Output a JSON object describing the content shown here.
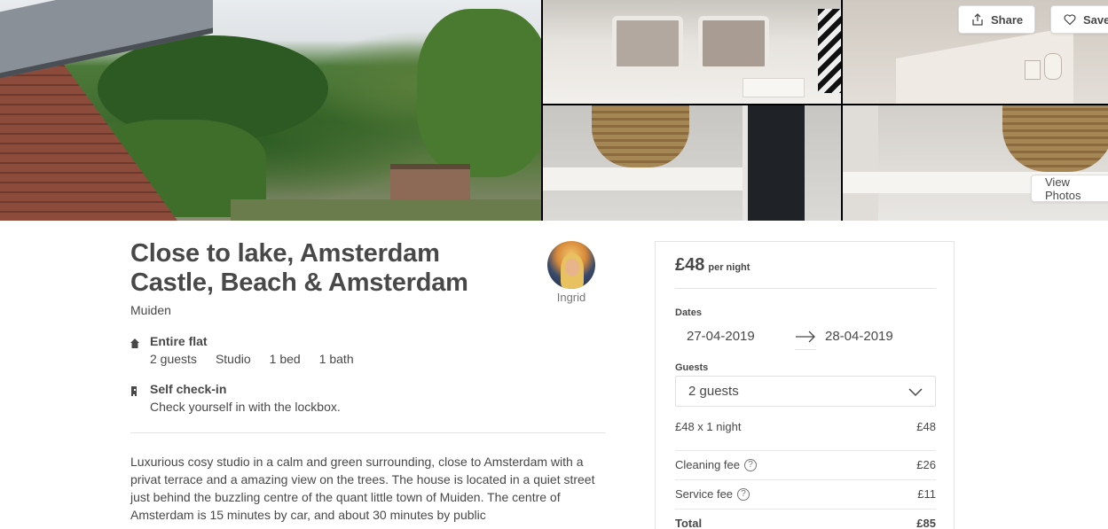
{
  "actions": {
    "share_label": "Share",
    "save_label": "Save",
    "view_photos_label": "View Photos"
  },
  "listing": {
    "title": "Close to lake, Amsterdam Castle, Beach & Amsterdam",
    "location": "Muiden",
    "host_name": "Ingrid",
    "features": [
      {
        "icon": "home-icon",
        "title": "Entire flat",
        "details": [
          "2 guests",
          "Studio",
          "1 bed",
          "1 bath"
        ]
      },
      {
        "icon": "key-icon",
        "title": "Self check-in",
        "subtitle": "Check yourself in with the lockbox."
      }
    ],
    "description": "Luxurious cosy studio in a calm and green surrounding, close to Amsterdam with a privat terrace and a amazing view on the trees. The house is located in a quiet street just behind the buzzling centre of the quant little town of Muiden. The centre of Amsterdam is 15 minutes by car, and about 30 minutes by public"
  },
  "booking": {
    "price": "£48",
    "per_night": "per night",
    "dates_label": "Dates",
    "check_in": "27-04-2019",
    "check_out": "28-04-2019",
    "guests_label": "Guests",
    "guests_value": "2 guests",
    "fees": [
      {
        "label": "£48 x 1 night",
        "value": "£48",
        "help": false
      },
      {
        "label": "Cleaning fee",
        "value": "£26",
        "help": true
      },
      {
        "label": "Service fee",
        "value": "£11",
        "help": true
      },
      {
        "label": "Total",
        "value": "£85",
        "help": false
      }
    ]
  },
  "colors": {
    "text": "#484848",
    "muted": "#767676",
    "border": "#e4e4e4"
  }
}
